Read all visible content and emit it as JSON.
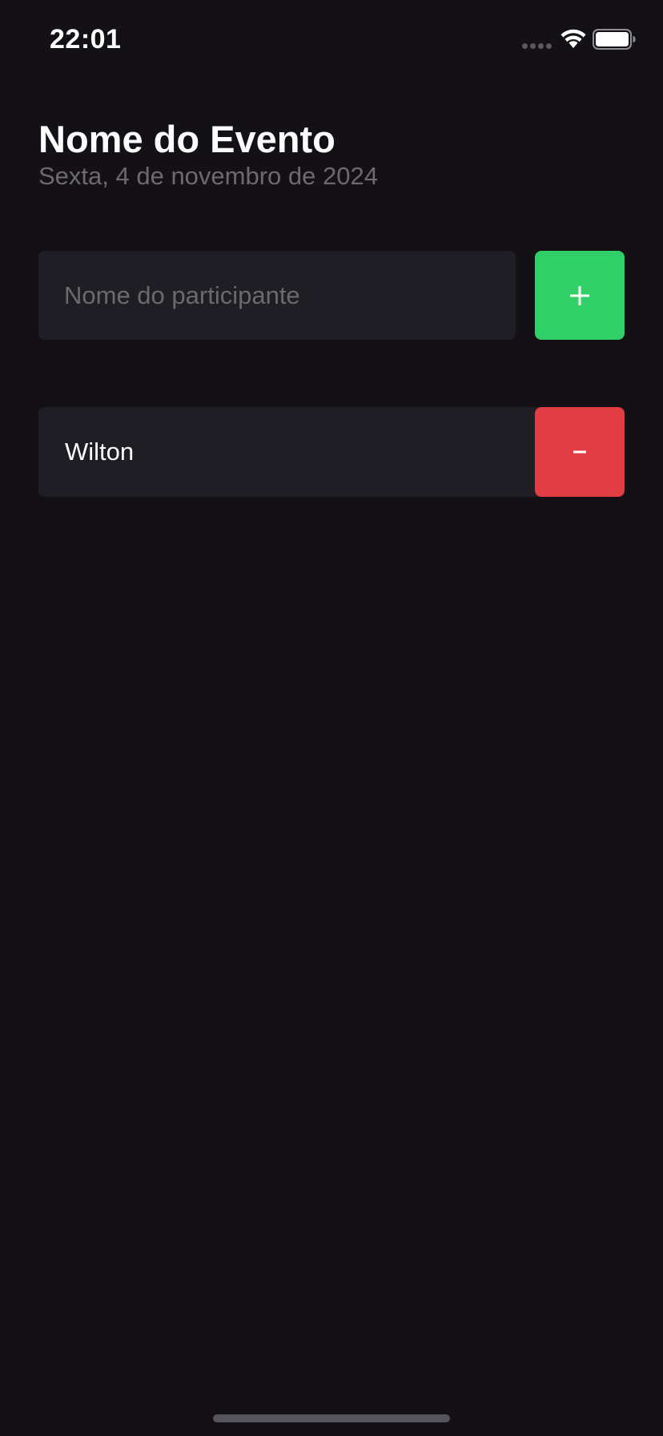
{
  "status_bar": {
    "time": "22:01",
    "wifi_icon": "wifi-icon",
    "battery_icon": "battery-icon"
  },
  "header": {
    "title": "Nome do Evento",
    "date": "Sexta, 4 de novembro de 2024"
  },
  "form": {
    "input_placeholder": "Nome do participante",
    "input_value": "",
    "add_button_label": "+"
  },
  "participants": [
    {
      "name": "Wilton",
      "remove_button_label": "-"
    }
  ],
  "colors": {
    "background": "#131016",
    "surface": "#1F1E25",
    "add_accent": "#31CF67",
    "remove_accent": "#E23C44",
    "muted_text": "#6B6B6B"
  }
}
